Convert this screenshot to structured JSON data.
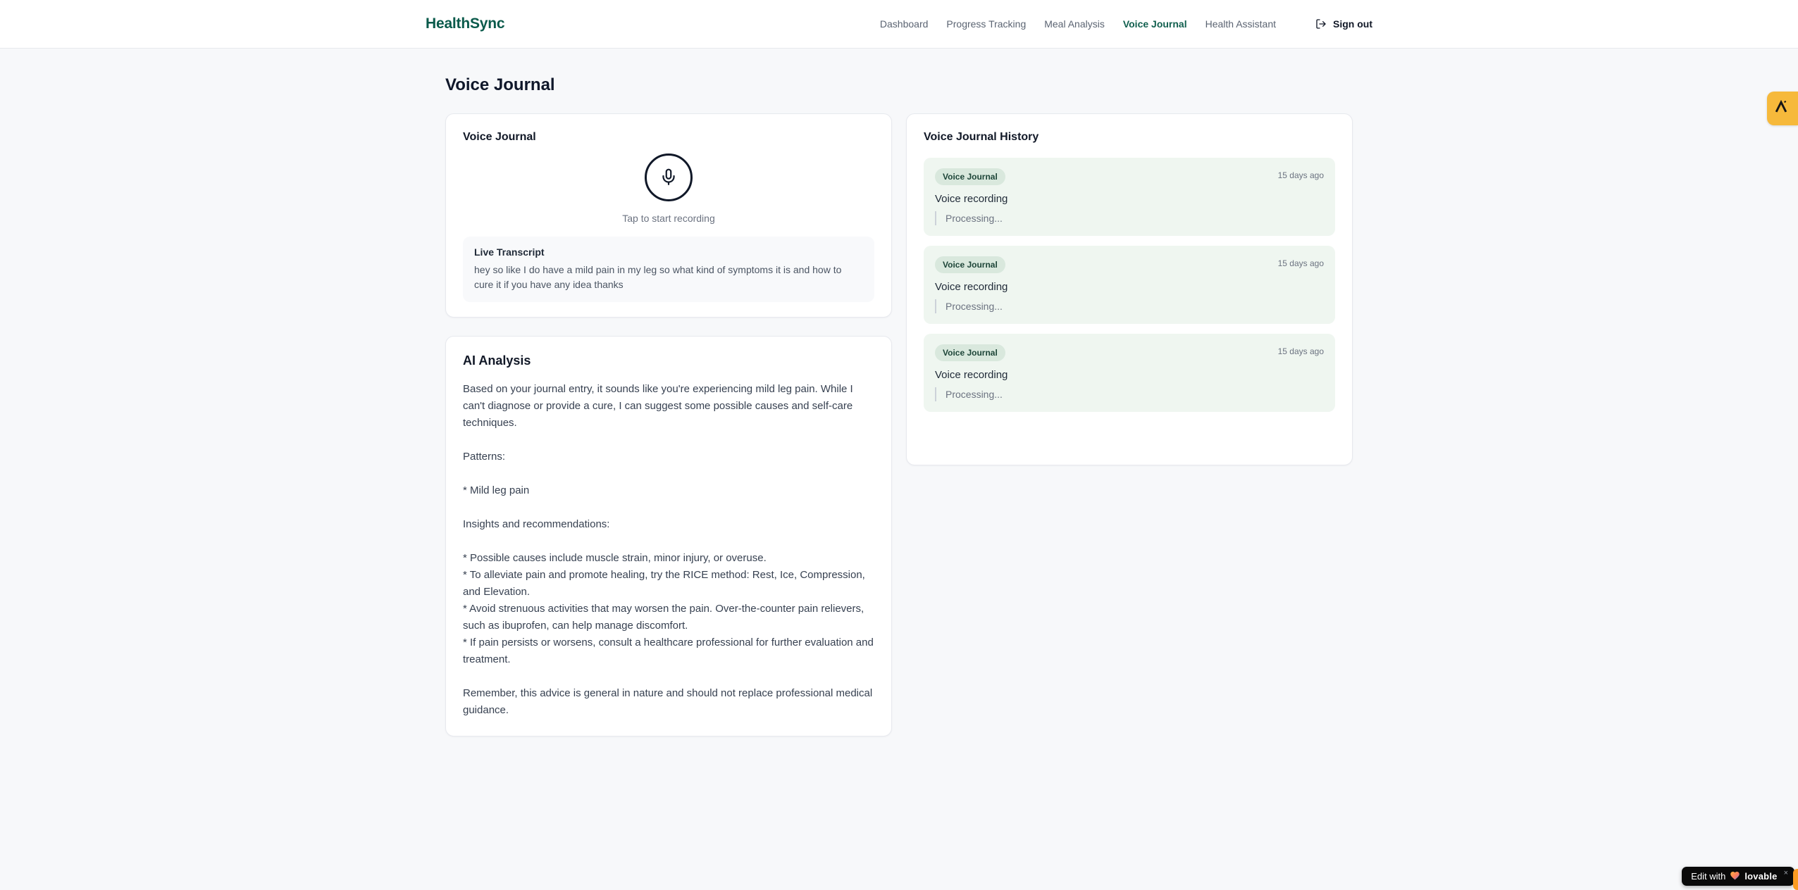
{
  "header": {
    "logo": "HealthSync",
    "nav": [
      {
        "label": "Dashboard",
        "active": false
      },
      {
        "label": "Progress Tracking",
        "active": false
      },
      {
        "label": "Meal Analysis",
        "active": false
      },
      {
        "label": "Voice Journal",
        "active": true
      },
      {
        "label": "Health Assistant",
        "active": false
      }
    ],
    "sign_out_label": "Sign out"
  },
  "page": {
    "title": "Voice Journal"
  },
  "recorder_card": {
    "title": "Voice Journal",
    "tap_hint": "Tap to start recording",
    "transcript_title": "Live Transcript",
    "transcript_text": "hey so like I do have a mild pain in my leg so what kind of symptoms it is and how to cure it if you have any idea thanks"
  },
  "analysis_card": {
    "title": "AI Analysis",
    "body": "Based on your journal entry, it sounds like you're experiencing mild leg pain. While I can't diagnose or provide a cure, I can suggest some possible causes and self-care techniques.\n\nPatterns:\n\n* Mild leg pain\n\nInsights and recommendations:\n\n* Possible causes include muscle strain, minor injury, or overuse.\n* To alleviate pain and promote healing, try the RICE method: Rest, Ice, Compression, and Elevation.\n* Avoid strenuous activities that may worsen the pain. Over-the-counter pain relievers, such as ibuprofen, can help manage discomfort.\n* If pain persists or worsens, consult a healthcare professional for further evaluation and treatment.\n\nRemember, this advice is general in nature and should not replace professional medical guidance."
  },
  "history_card": {
    "title": "Voice Journal History",
    "entries": [
      {
        "badge": "Voice Journal",
        "time": "15 days ago",
        "title": "Voice recording",
        "status": "Processing..."
      },
      {
        "badge": "Voice Journal",
        "time": "15 days ago",
        "title": "Voice recording",
        "status": "Processing..."
      },
      {
        "badge": "Voice Journal",
        "time": "15 days ago",
        "title": "Voice recording",
        "status": "Processing..."
      }
    ]
  },
  "floating": {
    "edit_prefix": "Edit with",
    "brand": "lovable",
    "close": "×"
  },
  "colors": {
    "brand_green": "#0a5a4b",
    "active_nav_green": "#12604f",
    "entry_bg": "#eff6f0",
    "badge_bg": "#d9e8dd",
    "badge_text": "#1d4538",
    "side_badge_amber": "#f6b93b",
    "corner_sliver_orange": "#fb9b22",
    "pill_black": "#0a0a0a",
    "page_bg": "#f7f8fa"
  }
}
